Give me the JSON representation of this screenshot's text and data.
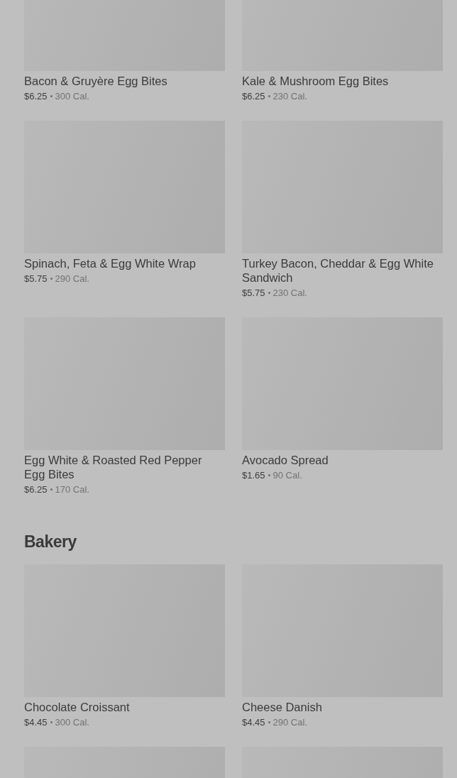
{
  "sections": [
    {
      "items": [
        {
          "kind": "product",
          "name": "Bacon & Gruyère Egg Bites",
          "price": "$6.25",
          "calories": "300 Cal."
        },
        {
          "kind": "product",
          "name": "Kale & Mushroom Egg Bites",
          "price": "$6.25",
          "calories": "230 Cal."
        },
        {
          "kind": "product",
          "name": "Spinach, Feta & Egg White Wrap",
          "price": "$5.75",
          "calories": "290 Cal."
        },
        {
          "kind": "product",
          "name": "Turkey Bacon, Cheddar & Egg White Sandwich",
          "price": "$5.75",
          "calories": "230 Cal."
        },
        {
          "kind": "product",
          "name": "Egg White & Roasted Red Pepper Egg Bites",
          "price": "$6.25",
          "calories": "170 Cal."
        },
        {
          "kind": "product",
          "name": "Avocado Spread",
          "price": "$1.65",
          "calories": "90 Cal."
        }
      ]
    },
    {
      "title": "Bakery",
      "items": [
        {
          "kind": "product",
          "name": "Chocolate Croissant",
          "price": "$4.45",
          "calories": "300 Cal."
        },
        {
          "kind": "product",
          "name": "Cheese Danish",
          "price": "$4.45",
          "calories": "290 Cal."
        },
        {
          "kind": "image-only"
        },
        {
          "kind": "image-only"
        }
      ]
    }
  ]
}
